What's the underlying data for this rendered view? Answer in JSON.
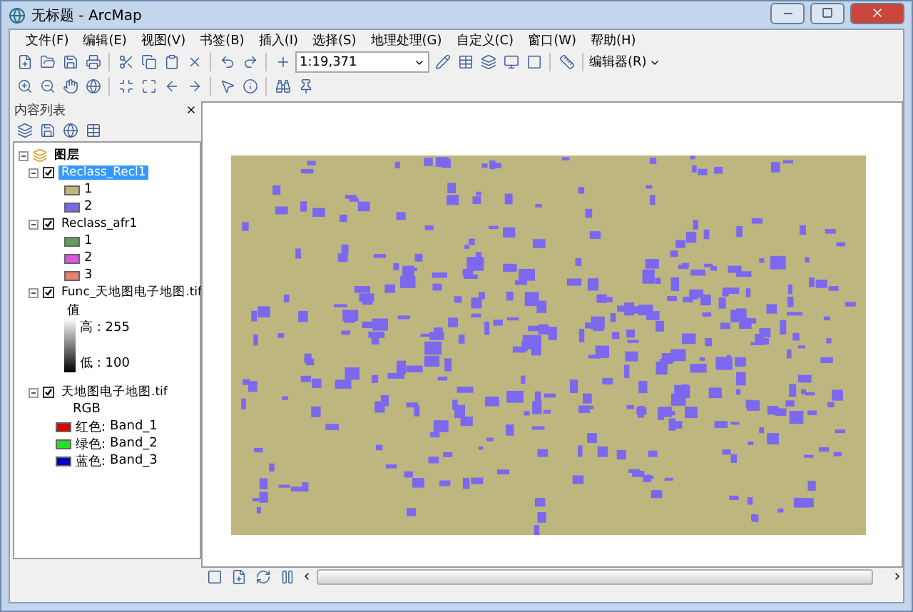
{
  "window": {
    "title": "无标题 - ArcMap"
  },
  "menu": [
    "文件(F)",
    "编辑(E)",
    "视图(V)",
    "书签(B)",
    "插入(I)",
    "选择(S)",
    "地理处理(G)",
    "自定义(C)",
    "窗口(W)",
    "帮助(H)"
  ],
  "toolbar": {
    "scale": "1:19,371",
    "editor": "编辑器(R)"
  },
  "toc": {
    "title": "内容列表",
    "group": {
      "name": "图层",
      "expanded": true,
      "layers": [
        {
          "name": "Reclass_Recl1",
          "checked": true,
          "selected": true,
          "expanded": true,
          "kind": "classes",
          "classes": [
            {
              "label": "1",
              "color": "#bdb67f"
            },
            {
              "label": "2",
              "color": "#7b68ee"
            }
          ]
        },
        {
          "name": "Reclass_afr1",
          "checked": true,
          "selected": false,
          "expanded": true,
          "kind": "classes",
          "classes": [
            {
              "label": "1",
              "color": "#5e9e62"
            },
            {
              "label": "2",
              "color": "#e055e0"
            },
            {
              "label": "3",
              "color": "#e8806e"
            }
          ]
        },
        {
          "name": "Func_天地图电子地图.tif",
          "checked": true,
          "selected": false,
          "expanded": true,
          "kind": "stretch",
          "heading": "值",
          "high": "高 : 255",
          "low": "低 : 100"
        },
        {
          "name": "天地图电子地图.tif",
          "checked": true,
          "selected": false,
          "expanded": true,
          "kind": "rgb",
          "heading": "RGB",
          "bands": [
            {
              "channel": "红色:",
              "band": "Band_1",
              "color": "#e00000"
            },
            {
              "channel": "绿色:",
              "band": "Band_2",
              "color": "#22e022"
            },
            {
              "channel": "蓝色:",
              "band": "Band_3",
              "color": "#0000c8"
            }
          ]
        }
      ]
    }
  }
}
